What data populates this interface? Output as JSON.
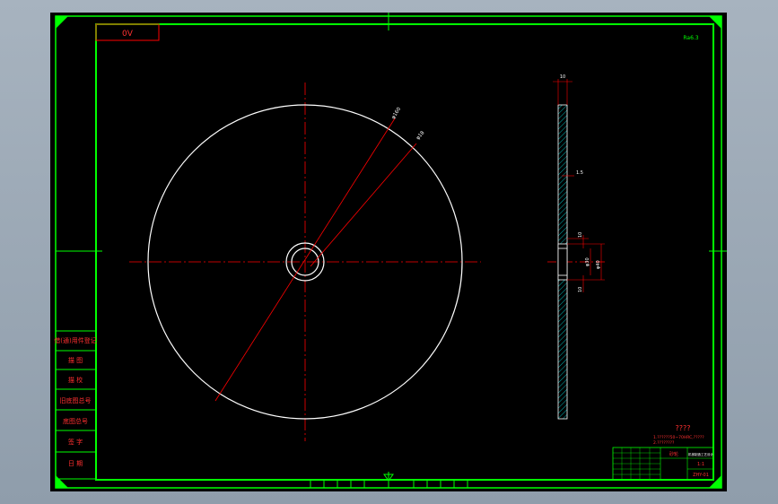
{
  "drawing": {
    "code_box": "0V",
    "corner_mark": "Ra6.3",
    "left_side_labels": [
      "借(通)用件登记",
      "描 图",
      "描 校",
      "旧底图总号",
      "底图总号",
      "签 字",
      "日 期"
    ],
    "front_view_dims": {
      "outer_dia": "φ160",
      "inner_dia": "φ18"
    },
    "section_view_dims": {
      "thickness": "10",
      "step": "1.5",
      "hub_top": "10",
      "hub_dia": "φ30",
      "hub_bore": "φ40",
      "hub_bottom": "10"
    },
    "notes_title": "????",
    "notes_line1": "1.??????50~70HRC,?????",
    "notes_line2": "2.????????",
    "title_block": {
      "part_name": "砂轮",
      "scale": "1:1",
      "sheet_code": "ZHY-01",
      "company": "机械制造工艺设计"
    }
  },
  "colors": {
    "sheet_bg": "#000000",
    "frame": "#00ff00",
    "geometry": "#ffffff",
    "centerline": "#ff0000",
    "dimension": "#ff0000",
    "hatch": "#00b0b0",
    "notes": "#ff3030"
  }
}
